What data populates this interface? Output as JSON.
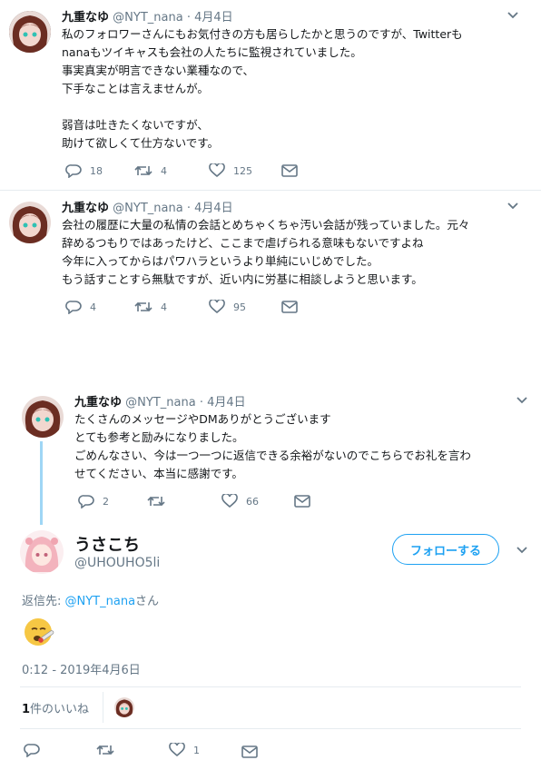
{
  "tweets": [
    {
      "name": "九重なゆ",
      "handle": "@NYT_nana",
      "sep": "·",
      "time": "4月4日",
      "lines": [
        "私のフォロワーさんにもお気付きの方も居らしたかと思うのですが、Twitterも",
        "nanaもツイキャスも会社の人たちに監視されていました。",
        "事実真実が明言できない業種なので、",
        "下手なことは言えませんが。",
        "",
        "弱音は吐きたくないですが、",
        "助けて欲しくて仕方ないです。"
      ],
      "replies": "18",
      "retweets": "4",
      "likes": "125"
    },
    {
      "name": "九重なゆ",
      "handle": "@NYT_nana",
      "sep": "·",
      "time": "4月4日",
      "lines": [
        "会社の履歴に大量の私情の会話とめちゃくちゃ汚い会話が残っていました。元々",
        "辞めるつもりではあったけど、ここまで虐げられる意味もないですよね",
        "今年に入ってからはパワハラというより単純にいじめでした。",
        "もう話すことすら無駄ですが、近い内に労基に相談しようと思います。"
      ],
      "replies": "4",
      "retweets": "4",
      "likes": "95"
    },
    {
      "name": "九重なゆ",
      "handle": "@NYT_nana",
      "sep": "·",
      "time": "4月4日",
      "lines": [
        "たくさんのメッセージやDMありがとうございます",
        "とても参考と励みになりました。",
        "ごめんなさい、今は一つ一つに返信できる余裕がないのでこちらでお礼を言わ",
        "せてください、本当に感謝です。"
      ],
      "replies": "2",
      "retweets": "",
      "likes": "66"
    }
  ],
  "reply": {
    "name": "うさこち",
    "handle": "@UHOUHO5li",
    "follow_label": "フォローする",
    "replying_prefix": "返信先: ",
    "replying_to": "@NYT_nana",
    "replying_suffix": "さん",
    "emoji": "🤒",
    "timestamp": "0:12 - 2019年4月6日",
    "likes_count": "1",
    "likes_label": "件のいいね",
    "action_likes": "1"
  },
  "colors": {
    "accent": "#1da1f2",
    "muted": "#657786",
    "divider": "#e6ecf0",
    "thread_line": "#9fd6f5"
  }
}
